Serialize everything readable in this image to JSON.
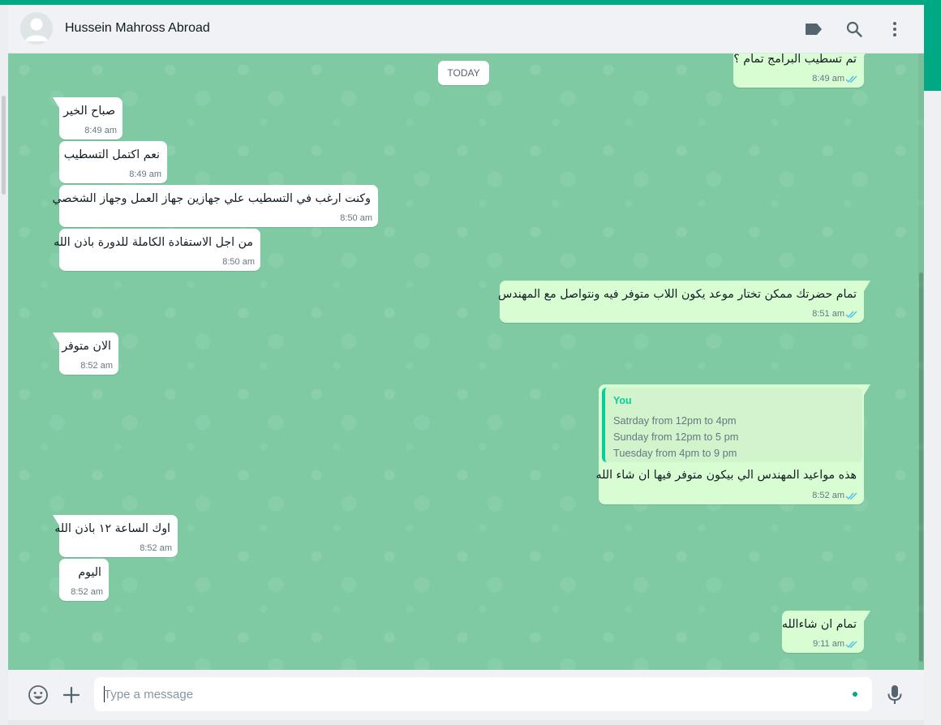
{
  "header": {
    "contact_name": "Hussein Mahross Abroad",
    "icons": [
      "avatar-placeholder",
      "label-icon",
      "search-icon",
      "menu-icon"
    ]
  },
  "chat": {
    "date_chip": "TODAY",
    "messages": [
      {
        "direction": "out",
        "text": "تم تسطيب البرامج تمام ؟",
        "time": "8:49 am",
        "status": "read"
      },
      {
        "direction": "in",
        "text": "صباح الخير",
        "time": "8:49 am"
      },
      {
        "direction": "in",
        "text": "نعم اكتمل التسطيب",
        "time": "8:49 am"
      },
      {
        "direction": "in",
        "text": "وكنت ارغب في التسطيب علي جهازين جهاز العمل وجهاز الشخصي",
        "time": "8:50 am"
      },
      {
        "direction": "in",
        "text": "من اجل الاستفادة الكاملة للدورة باذن الله",
        "time": "8:50 am"
      },
      {
        "direction": "out",
        "text": "تمام حضرتك ممكن تختار موعد يكون اللاب متوفر فيه ونتواصل مع المهندس",
        "time": "8:51 am",
        "status": "read"
      },
      {
        "direction": "in",
        "text": "الان متوفر",
        "time": "8:52 am"
      },
      {
        "direction": "out",
        "text": "هذه مواعيد المهندس الي بيكون متوفر فيها ان شاء الله",
        "time": "8:52 am",
        "status": "read",
        "quote": {
          "author": "You",
          "lines": [
            "Satrday from 12pm to 4pm",
            "Sunday from 12pm to 5 pm",
            "Tuesday from 4pm to 9 pm"
          ]
        }
      },
      {
        "direction": "in",
        "text": "اوك الساعة ١٢ باذن الله",
        "time": "8:52 am"
      },
      {
        "direction": "in",
        "text": "اليوم",
        "time": "8:52 am"
      },
      {
        "direction": "out",
        "text": "تمام ان شاءالله",
        "time": "9:11 am",
        "status": "read"
      }
    ]
  },
  "footer": {
    "placeholder": "Type a message",
    "value": "",
    "icons": [
      "emoji-icon",
      "attach-plus-icon",
      "microphone-icon"
    ]
  },
  "colors": {
    "accent": "#00a884",
    "chat_background": "#7fcaa3",
    "outgoing_bubble": "#d9fdd3",
    "incoming_bubble": "#ffffff",
    "read_ticks": "#53bdeb",
    "quote_author": "#06cf9c"
  }
}
